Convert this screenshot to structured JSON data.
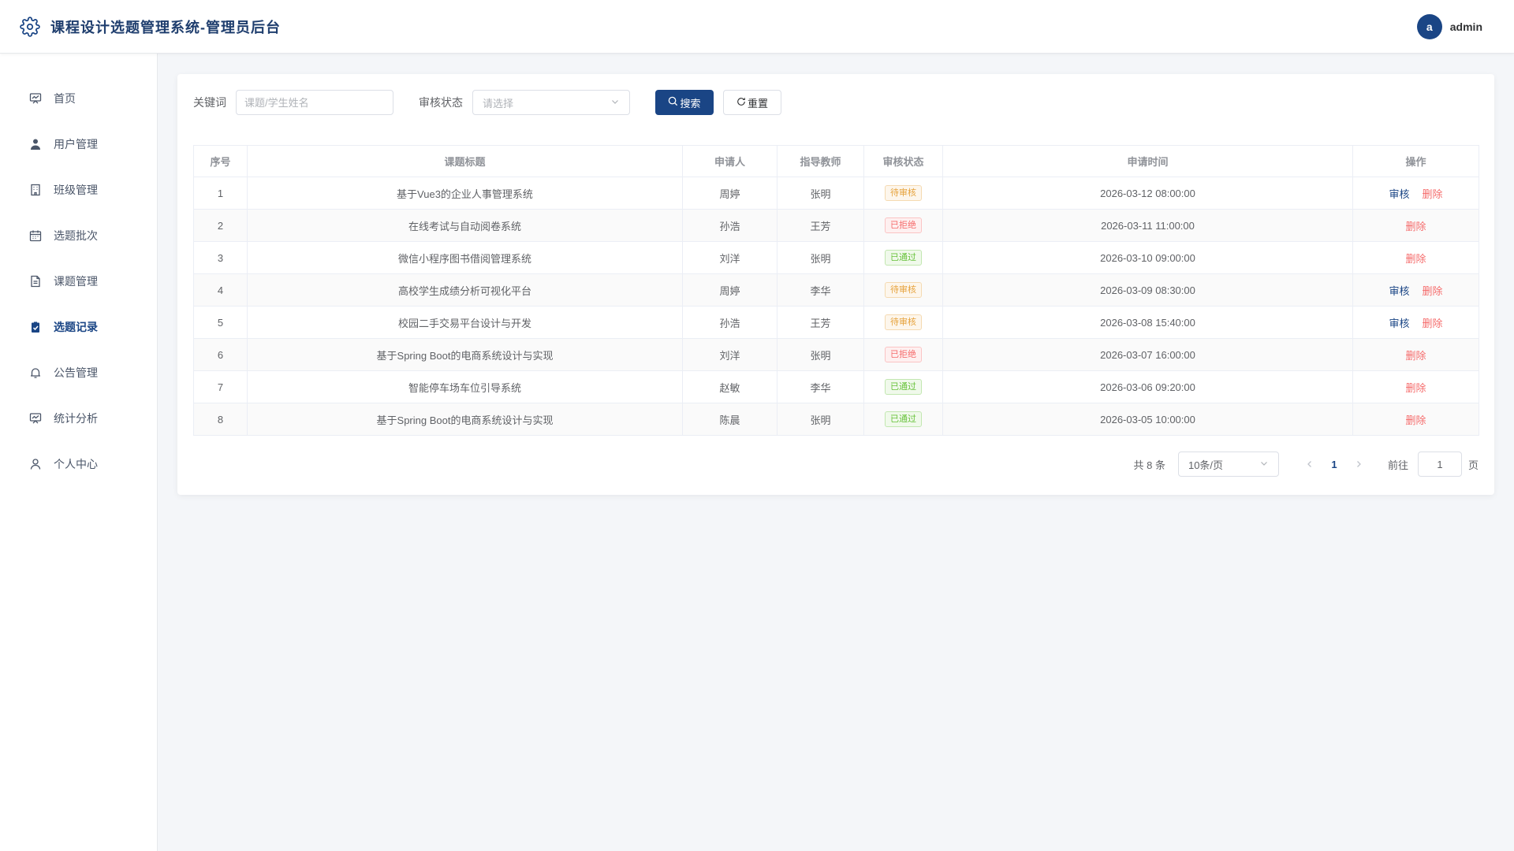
{
  "header": {
    "title": "课程设计选题管理系统-管理员后台",
    "avatar_letter": "a",
    "user_name": "admin"
  },
  "sidebar": {
    "items": [
      {
        "label": "首页",
        "icon": "dashboard-icon"
      },
      {
        "label": "用户管理",
        "icon": "user-icon"
      },
      {
        "label": "班级管理",
        "icon": "building-icon"
      },
      {
        "label": "选题批次",
        "icon": "calendar-icon"
      },
      {
        "label": "课题管理",
        "icon": "document-icon"
      },
      {
        "label": "选题记录",
        "icon": "clipboard-check-icon",
        "active": true
      },
      {
        "label": "公告管理",
        "icon": "bell-icon"
      },
      {
        "label": "统计分析",
        "icon": "chart-icon"
      },
      {
        "label": "个人中心",
        "icon": "user-outline-icon"
      }
    ]
  },
  "filter": {
    "keyword_label": "关键词",
    "keyword_placeholder": "课题/学生姓名",
    "status_label": "审核状态",
    "status_placeholder": "请选择",
    "search_label": "搜索",
    "reset_label": "重置"
  },
  "table": {
    "headers": [
      "序号",
      "课题标题",
      "申请人",
      "指导教师",
      "审核状态",
      "申请时间",
      "操作"
    ],
    "action_review": "审核",
    "action_delete": "删除",
    "rows": [
      {
        "no": "1",
        "title": "基于Vue3的企业人事管理系统",
        "applicant": "周婷",
        "teacher": "张明",
        "status": "待审核",
        "status_type": "pending",
        "time": "2026-03-12 08:00:00",
        "can_review": true
      },
      {
        "no": "2",
        "title": "在线考试与自动阅卷系统",
        "applicant": "孙浩",
        "teacher": "王芳",
        "status": "已拒绝",
        "status_type": "rejected",
        "time": "2026-03-11 11:00:00",
        "can_review": false
      },
      {
        "no": "3",
        "title": "微信小程序图书借阅管理系统",
        "applicant": "刘洋",
        "teacher": "张明",
        "status": "已通过",
        "status_type": "approved",
        "time": "2026-03-10 09:00:00",
        "can_review": false
      },
      {
        "no": "4",
        "title": "高校学生成绩分析可视化平台",
        "applicant": "周婷",
        "teacher": "李华",
        "status": "待审核",
        "status_type": "pending",
        "time": "2026-03-09 08:30:00",
        "can_review": true
      },
      {
        "no": "5",
        "title": "校园二手交易平台设计与开发",
        "applicant": "孙浩",
        "teacher": "王芳",
        "status": "待审核",
        "status_type": "pending",
        "time": "2026-03-08 15:40:00",
        "can_review": true
      },
      {
        "no": "6",
        "title": "基于Spring Boot的电商系统设计与实现",
        "applicant": "刘洋",
        "teacher": "张明",
        "status": "已拒绝",
        "status_type": "rejected",
        "time": "2026-03-07 16:00:00",
        "can_review": false
      },
      {
        "no": "7",
        "title": "智能停车场车位引导系统",
        "applicant": "赵敏",
        "teacher": "李华",
        "status": "已通过",
        "status_type": "approved",
        "time": "2026-03-06 09:20:00",
        "can_review": false
      },
      {
        "no": "8",
        "title": "基于Spring Boot的电商系统设计与实现",
        "applicant": "陈晨",
        "teacher": "张明",
        "status": "已通过",
        "status_type": "approved",
        "time": "2026-03-05 10:00:00",
        "can_review": false
      }
    ]
  },
  "pagination": {
    "total_text": "共 8 条",
    "page_size": "10条/页",
    "current_page": "1",
    "goto_label": "前往",
    "goto_value": "1",
    "page_suffix": "页"
  },
  "colors": {
    "primary": "#1a4585",
    "danger": "#f56c6c",
    "warning": "#e6a23c",
    "success": "#67c23a"
  }
}
